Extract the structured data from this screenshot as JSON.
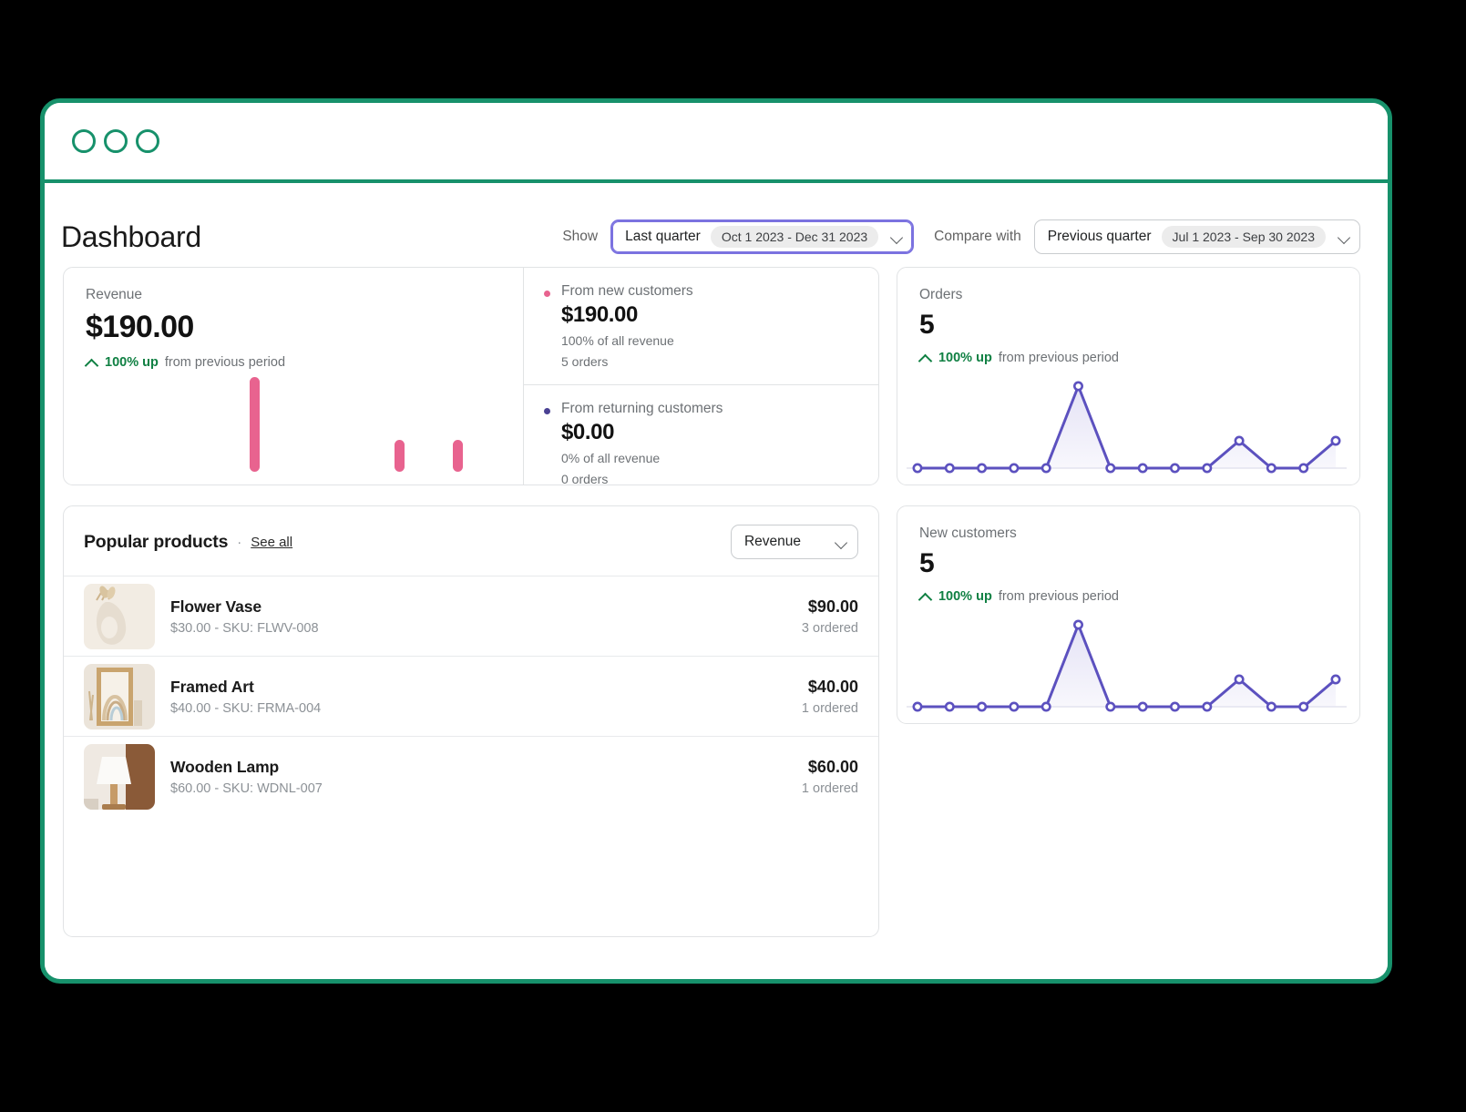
{
  "window": {
    "accent_color": "#17916b",
    "dots": [
      "window-dot-1",
      "window-dot-2",
      "window-dot-3"
    ]
  },
  "header": {
    "title": "Dashboard",
    "show_label": "Show",
    "show_select": {
      "value": "Last quarter",
      "range": "Oct 1 2023 - Dec 31 2023",
      "icon": "chevron-down-icon"
    },
    "compare_label": "Compare with",
    "compare_select": {
      "value": "Previous quarter",
      "range": "Jul 1 2023 - Sep 30 2023",
      "icon": "chevron-down-icon"
    }
  },
  "revenue_card": {
    "label": "Revenue",
    "value": "$190.00",
    "trend_strong": "100% up",
    "trend_rest": "from previous period",
    "trend_icon": "caret-up-icon",
    "trend_color": "#108043",
    "bar_color": "#e8638f",
    "breakdown": [
      {
        "dot_color": "#e8638f",
        "title": "From new customers",
        "value": "$190.00",
        "sub1": "100% of all revenue",
        "sub2": "5 orders"
      },
      {
        "dot_color": "#4a4193",
        "title": "From returning customers",
        "value": "$0.00",
        "sub1": "0% of all revenue",
        "sub2": "0 orders"
      }
    ]
  },
  "products_card": {
    "title": "Popular products",
    "separator": "·",
    "see_all": "See all",
    "sort": {
      "value": "Revenue",
      "icon": "chevron-down-icon"
    },
    "items": [
      {
        "thumb": "flower-vase-photo",
        "name": "Flower Vase",
        "meta": "$30.00 - SKU: FLWV-008",
        "amount": "$90.00",
        "count": "3 ordered"
      },
      {
        "thumb": "framed-art-photo",
        "name": "Framed Art",
        "meta": "$40.00 - SKU: FRMA-004",
        "amount": "$40.00",
        "count": "1 ordered"
      },
      {
        "thumb": "wooden-lamp-photo",
        "name": "Wooden Lamp",
        "meta": "$60.00 - SKU: WDNL-007",
        "amount": "$60.00",
        "count": "1 ordered"
      }
    ]
  },
  "orders_card": {
    "label": "Orders",
    "value": "5",
    "trend_strong": "100% up",
    "trend_rest": "from previous period",
    "trend_icon": "caret-up-icon"
  },
  "new_customers_card": {
    "label": "New customers",
    "value": "5",
    "trend_strong": "100% up",
    "trend_rest": "from previous period",
    "trend_icon": "caret-up-icon"
  },
  "chart_data": [
    {
      "type": "bar",
      "name": "revenue-bar-chart",
      "title": "Revenue",
      "categories": [
        "1",
        "2",
        "3",
        "4",
        "5",
        "6",
        "7",
        "8",
        "9",
        "10",
        "11",
        "12",
        "13",
        "14"
      ],
      "values": [
        0,
        0,
        0,
        0,
        0,
        90,
        0,
        0,
        0,
        0,
        30,
        0,
        30,
        0
      ],
      "ylim": [
        0,
        100
      ],
      "ylabel": "",
      "xlabel": "",
      "grid": false,
      "legend": "none",
      "color": "#e8638f"
    },
    {
      "type": "area",
      "name": "orders-line-chart",
      "title": "Orders",
      "x": [
        1,
        2,
        3,
        4,
        5,
        6,
        7,
        8,
        9,
        10,
        11,
        12,
        13,
        14
      ],
      "values": [
        0,
        0,
        0,
        0,
        0,
        3,
        0,
        0,
        0,
        0,
        1,
        0,
        0,
        1
      ],
      "ylim": [
        0,
        3
      ],
      "ylabel": "",
      "xlabel": "",
      "grid": false,
      "legend": "none",
      "color": "#5c51bf",
      "fill": "#e3e1f5"
    },
    {
      "type": "area",
      "name": "new-customers-line-chart",
      "title": "New customers",
      "x": [
        1,
        2,
        3,
        4,
        5,
        6,
        7,
        8,
        9,
        10,
        11,
        12,
        13,
        14
      ],
      "values": [
        0,
        0,
        0,
        0,
        0,
        3,
        0,
        0,
        0,
        0,
        1,
        0,
        0,
        1
      ],
      "ylim": [
        0,
        3
      ],
      "ylabel": "",
      "xlabel": "",
      "grid": false,
      "legend": "none",
      "color": "#5c51bf",
      "fill": "#e3e1f5"
    }
  ]
}
